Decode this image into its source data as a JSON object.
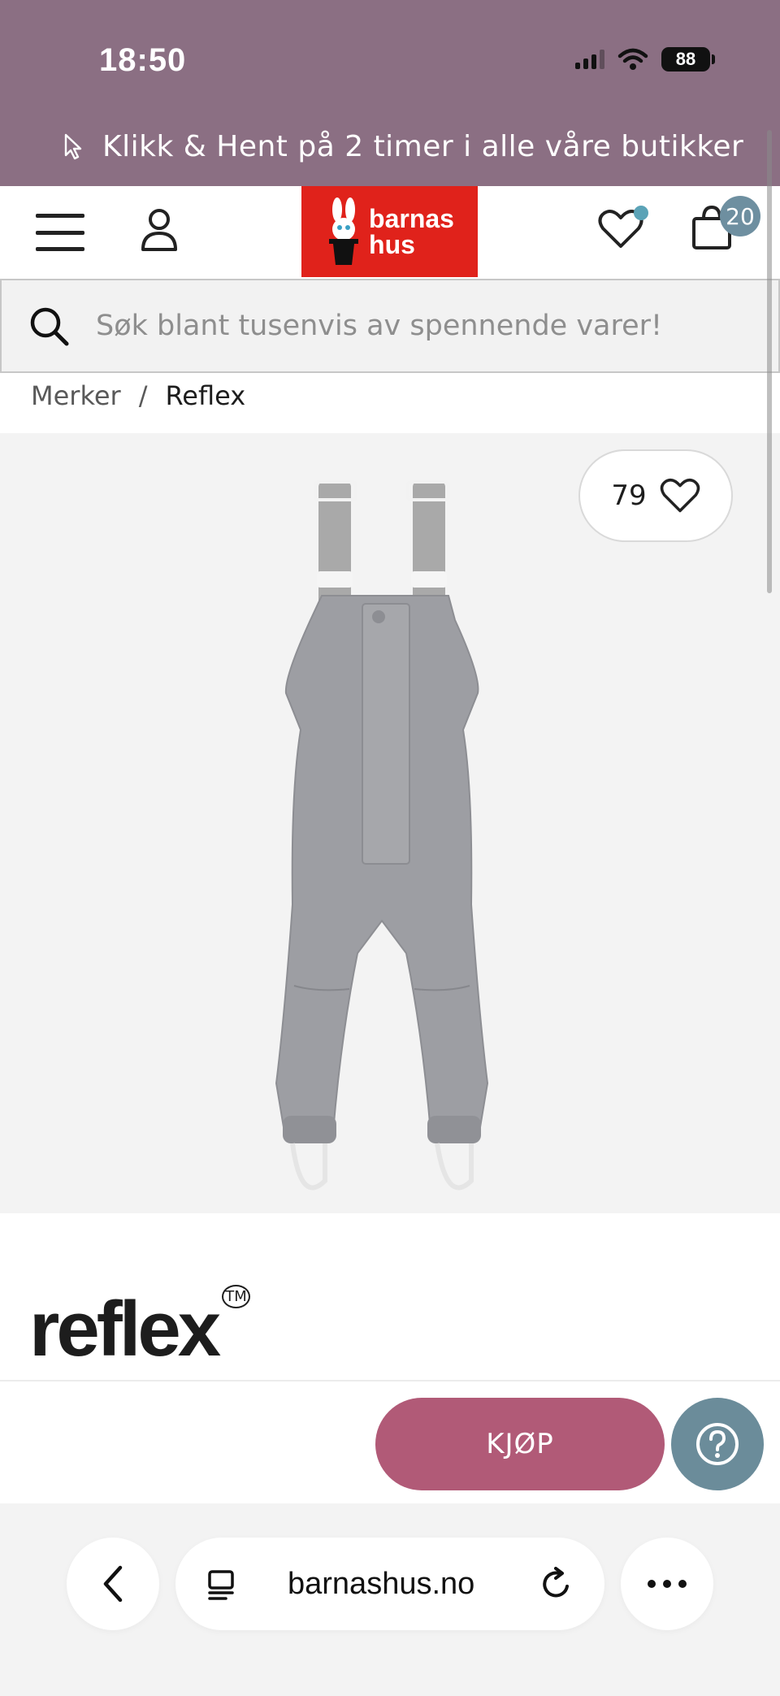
{
  "status_bar": {
    "time": "18:50",
    "battery": "88"
  },
  "promo_banner": {
    "text": "Klikk & Hent på 2 timer i alle våre butikker"
  },
  "header": {
    "logo_line1": "barnas",
    "logo_line2": "hus",
    "cart_count": "20"
  },
  "search": {
    "placeholder": "Søk blant tusenvis av spennende varer!"
  },
  "breadcrumb": {
    "items": [
      "Merker",
      "Reflex"
    ],
    "separator": "/"
  },
  "product": {
    "like_count": "79",
    "brand": "reflex"
  },
  "actions": {
    "buy_label": "KJØP"
  },
  "browser": {
    "url": "barnashus.no"
  },
  "colors": {
    "banner": "#8b6f83",
    "logo_red": "#e0221b",
    "buy": "#b15a77",
    "help": "#6b8c9a",
    "badge": "#6e8fa0"
  }
}
